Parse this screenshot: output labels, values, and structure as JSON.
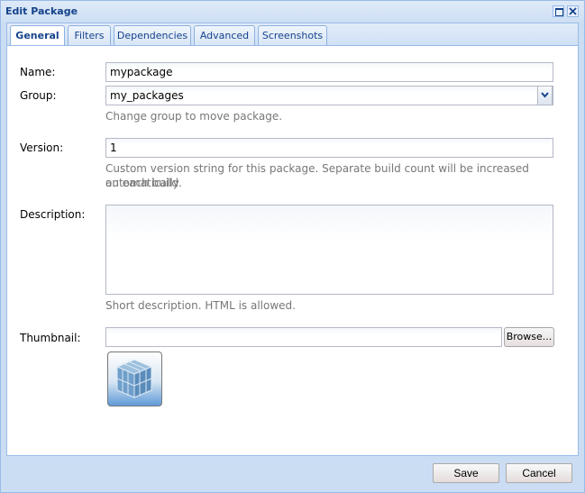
{
  "window": {
    "title": "Edit Package",
    "maximize_icon": "maximize-icon",
    "close_icon": "close-icon"
  },
  "tabs": [
    {
      "label": "General",
      "active": true
    },
    {
      "label": "Filters",
      "active": false
    },
    {
      "label": "Dependencies",
      "active": false
    },
    {
      "label": "Advanced",
      "active": false
    },
    {
      "label": "Screenshots",
      "active": false
    }
  ],
  "form": {
    "name": {
      "label": "Name:",
      "value": "mypackage"
    },
    "group": {
      "label": "Group:",
      "value": "my_packages",
      "hint": "Change group to move package."
    },
    "version": {
      "label": "Version:",
      "value": "1",
      "hint_line1": "Custom version string for this package. Separate build count will be increased automatically",
      "hint_line2": "on each build."
    },
    "description": {
      "label": "Description:",
      "value": "",
      "hint": "Short description. HTML is allowed."
    },
    "thumbnail": {
      "label": "Thumbnail:",
      "value": "",
      "browse_label": "Browse...",
      "image_icon": "package-cube-icon"
    }
  },
  "footer": {
    "save_label": "Save",
    "cancel_label": "Cancel"
  },
  "colors": {
    "title_text": "#15428b",
    "frame_bg": "#cbddf3",
    "border": "#99bbe8",
    "hint_text": "#777777"
  }
}
